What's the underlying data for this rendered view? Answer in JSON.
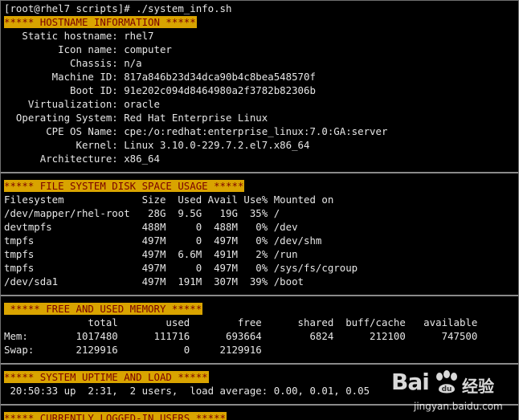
{
  "terminal": {
    "prompt": "[root@rhel7 scripts]# ./system_info.sh",
    "sections": {
      "hostname_header": "***** HOSTNAME INFORMATION *****",
      "hostname_lines": [
        "   Static hostname: rhel7",
        "         Icon name: computer",
        "           Chassis: n/a",
        "        Machine ID: 817a846b23d34dca90b4c8bea548570f",
        "           Boot ID: 91e202c094d8464980a2f3782b82306b",
        "    Virtualization: oracle",
        "  Operating System: Red Hat Enterprise Linux",
        "       CPE OS Name: cpe:/o:redhat:enterprise_linux:7.0:GA:server",
        "            Kernel: Linux 3.10.0-229.7.2.el7.x86_64",
        "      Architecture: x86_64"
      ],
      "disk_header": "***** FILE SYSTEM DISK SPACE USAGE *****",
      "disk_lines": [
        "Filesystem             Size  Used Avail Use% Mounted on",
        "/dev/mapper/rhel-root   28G  9.5G   19G  35% /",
        "devtmpfs               488M     0  488M   0% /dev",
        "tmpfs                  497M     0  497M   0% /dev/shm",
        "tmpfs                  497M  6.6M  491M   2% /run",
        "tmpfs                  497M     0  497M   0% /sys/fs/cgroup",
        "/dev/sda1              497M  191M  307M  39% /boot"
      ],
      "memory_header": " ***** FREE AND USED MEMORY *****",
      "memory_lines": [
        "              total        used        free      shared  buff/cache   available",
        "Mem:        1017480      111716      693664        6824      212100      747500",
        "Swap:       2129916           0     2129916"
      ],
      "uptime_header": "***** SYSTEM UPTIME AND LOAD *****",
      "uptime_line": " 20:50:33 up  2:31,  2 users,  load average: 0.00, 0.01, 0.05",
      "users_header": "***** CURRENTLY LOGGED-IN USERS *****"
    }
  },
  "watermark": {
    "brand": "Bai",
    "brand_cn": "经验",
    "url": "jingyan.baidu.com"
  },
  "colors": {
    "background": "#000000",
    "text": "#e6e6e6",
    "header_bg": "#d9a400",
    "header_text": "#7a0000"
  }
}
